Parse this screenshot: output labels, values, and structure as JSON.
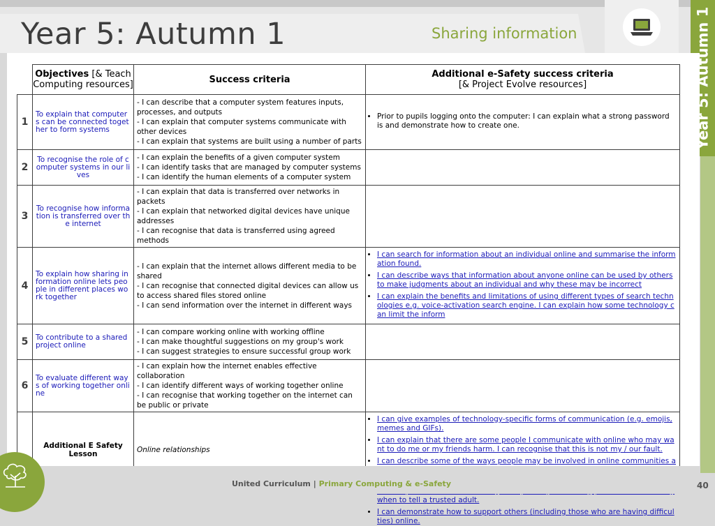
{
  "header": {
    "title": "Year 5: Autumn 1",
    "subtitle": "Sharing information",
    "icon": "laptop-icon",
    "side_tab": "Year 5: Autumn 1"
  },
  "colors": {
    "accent_green": "#8aa63c",
    "link_blue": "#1a1ab8",
    "title_gray": "#3d3d3d"
  },
  "table": {
    "headers": {
      "objectives_bold": "Objectives",
      "objectives_rest": " [& Teach Computing resources]",
      "success": "Success criteria",
      "esafety_bold": "Additional e-Safety success criteria",
      "esafety_rest": "[& Project Evolve resources]"
    },
    "rows": [
      {
        "num": "1",
        "objective": "To explain that computers can be connected together to form systems",
        "criteria": [
          "- I can describe that a computer system features inputs, processes, and outputs",
          "- I can explain that computer systems communicate with other devices",
          "- I can explain that systems are built using a number of parts"
        ],
        "esafety": [
          "Prior to pupils logging onto the computer: I can explain what a strong password is and demonstrate how to create one."
        ]
      },
      {
        "num": "2",
        "objective": "To recognise the role of computer systems in our lives",
        "criteria": [
          "- I can explain the benefits of a given computer system",
          "- I can identify tasks that are managed by computer systems",
          "- I can identify the human elements of a computer system"
        ],
        "esafety": []
      },
      {
        "num": "3",
        "objective": "To recognise how information is transferred over the internet",
        "criteria": [
          "- I can explain that data is transferred over networks in packets",
          "- I can explain that networked digital devices have unique addresses",
          "- I can recognise that data is transferred using agreed methods"
        ],
        "esafety": []
      },
      {
        "num": "4",
        "objective": "To explain how sharing information online lets people in different places work together",
        "criteria": [
          "- I can explain that the internet allows different media to be shared",
          "- I can recognise that connected digital devices can allow us to access shared files stored online",
          "- I can send information over the internet in different ways"
        ],
        "esafety": [
          "I can search for information about an individual online and summarise the information found.",
          "I can describe ways that information about anyone online can be used by others to make judgments about an individual and why these may be incorrect",
          "I can explain the benefits and limitations of using different types of search technologies e.g. voice-activation search engine. I can explain how some technology can limit the inform"
        ]
      },
      {
        "num": "5",
        "objective": "To contribute to a shared project online",
        "criteria": [
          "- I can compare working online with working offline",
          "- I can make thoughtful suggestions on my group's work",
          "- I can suggest strategies to ensure successful group work"
        ],
        "esafety": []
      },
      {
        "num": "6",
        "objective": "To evaluate different ways of working together online",
        "criteria": [
          "- I can explain how the internet enables effective collaboration",
          "- I can identify different ways of working together online",
          "- I can recognise that working together on the internet can be public or private"
        ],
        "esafety": []
      }
    ],
    "additional": {
      "label": "Additional E Safety Lesson",
      "criteria": "Online relationships",
      "esafety": [
        "I can give examples of technology-specific forms of communication (e.g. emojis, memes and GIFs).",
        "I can explain that there are some people I communicate with online who may want to do me or my friends harm. I can recognise that this is not my / our fault.",
        "I can describe some of the ways people may be involved in online communities and describe how they might collaborate constructively with others and make positive contributions. (e.g. gaming communities or social media groups).",
        "I can explain how someone can get help if they are having problems and identify when to tell a trusted adult.",
        "I can demonstrate how to support others (including those who are having difficulties) online."
      ]
    }
  },
  "footer": {
    "left": "United Curriculum",
    "separator": " | ",
    "right": "Primary Computing & e-Safety",
    "page": "40",
    "logo": "tree-logo-icon"
  }
}
